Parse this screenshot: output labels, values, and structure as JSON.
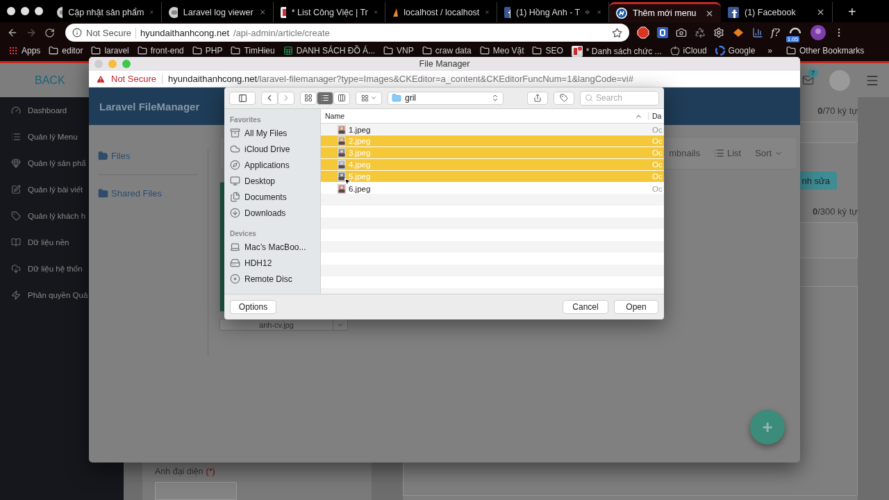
{
  "browser": {
    "tabs": [
      {
        "title": "Cập nhật sản phẩm",
        "kind": "circle",
        "selected": false,
        "audio": false
      },
      {
        "title": "Laravel log viewer",
        "kind": "circle",
        "selected": false,
        "audio": false
      },
      {
        "title": "* List Công Việc | Tr",
        "kind": "todo",
        "selected": false,
        "audio": false
      },
      {
        "title": "localhost / localhost",
        "kind": "sails",
        "selected": false,
        "audio": false
      },
      {
        "title": "(1) Hồng Anh - T",
        "kind": "facebook",
        "selected": false,
        "audio": true
      },
      {
        "title": "Thêm mới menu",
        "kind": "brand",
        "selected": true,
        "audio": false
      },
      {
        "title": "(1) Facebook",
        "kind": "facebook",
        "selected": false,
        "audio": false
      }
    ],
    "new_tab": "+",
    "address": {
      "security": "Not Secure",
      "host": "hyundaithanhcong.net",
      "path": "/api-admin/article/create"
    },
    "extension_text": "f?",
    "extension_badge": "1.05",
    "bookmarks": [
      {
        "label": "Apps",
        "kind": "apps"
      },
      {
        "label": "editor",
        "kind": "folder"
      },
      {
        "label": "laravel",
        "kind": "folder"
      },
      {
        "label": "front-end",
        "kind": "folder"
      },
      {
        "label": "PHP",
        "kind": "folder"
      },
      {
        "label": "TimHieu",
        "kind": "folder"
      },
      {
        "label": "DANH SÁCH ĐỒ Á...",
        "kind": "sheet"
      },
      {
        "label": "VNP",
        "kind": "folder"
      },
      {
        "label": "craw data",
        "kind": "folder"
      },
      {
        "label": "Meo Vặt",
        "kind": "folder"
      },
      {
        "label": "SEO",
        "kind": "folder"
      },
      {
        "label": "* Danh sách chức ...",
        "kind": "todo"
      },
      {
        "label": "iCloud",
        "kind": "apple"
      },
      {
        "label": "Google",
        "kind": "google"
      }
    ],
    "more": "»",
    "other_bookmarks": "Other Bookmarks"
  },
  "page": {
    "back": "BACK",
    "mail_count": "7",
    "sidebar": [
      {
        "label": "Dashboard",
        "kind": "gauge"
      },
      {
        "label": "Quản lý Menu",
        "kind": "list"
      },
      {
        "label": "Quản lý sản phẩ",
        "kind": "gem"
      },
      {
        "label": "Quản lý bài viết",
        "kind": "edit"
      },
      {
        "label": "Quản lý khách h",
        "kind": "tag"
      },
      {
        "label": "Dữ liệu nền",
        "kind": "book"
      },
      {
        "label": "Dữ liệu hệ thốn",
        "kind": "cloud"
      },
      {
        "label": "Phân quyền Quả",
        "kind": "bolt"
      }
    ],
    "title_counter": "**0**/70 ký tự",
    "edit_button": "nh sửa",
    "desc_counter": "**0**/300 ký tự",
    "avatar_label": "Anh đại diện",
    "required_mark": "(*)"
  },
  "popup": {
    "title": "File Manager",
    "security": "Not Secure",
    "host": "hyundaithanhcong.net",
    "path": "/laravel-filemanager?type=Images&CKEditor=a_content&CKEditorFuncNum=1&langCode=vi#",
    "brand": "Laravel FileManager",
    "folders": [
      {
        "label": "Files",
        "open": true
      },
      {
        "label": "Shared Files",
        "open": false
      }
    ],
    "thumbnails": "mbnails",
    "list": "List",
    "sort": "Sort",
    "file_select": "anh-cv.jpg",
    "fab": "+"
  },
  "dialog": {
    "view_modes": [
      {
        "kind": "icons",
        "selected": false
      },
      {
        "kind": "list",
        "selected": true
      },
      {
        "kind": "columns",
        "selected": false
      }
    ],
    "folder": "gril",
    "search_placeholder": "Search",
    "favorites_heading": "Favorites",
    "favorites": [
      {
        "label": "All My Files",
        "kind": "files"
      },
      {
        "label": "iCloud Drive",
        "kind": "cloud"
      },
      {
        "label": "Applications",
        "kind": "apps"
      },
      {
        "label": "Desktop",
        "kind": "desktop"
      },
      {
        "label": "Documents",
        "kind": "documents"
      },
      {
        "label": "Downloads",
        "kind": "downloads"
      }
    ],
    "devices_heading": "Devices",
    "devices": [
      {
        "label": "Mac’s MacBoo...",
        "kind": "laptop"
      },
      {
        "label": "HDH12",
        "kind": "disk"
      },
      {
        "label": "Remote Disc",
        "kind": "disc"
      }
    ],
    "columns": [
      "Name",
      "Da"
    ],
    "files": [
      {
        "name": "1.jpeg",
        "date": "Oc",
        "selected": false
      },
      {
        "name": "2.jpeg",
        "date": "Oc",
        "selected": true
      },
      {
        "name": "3.jpeg",
        "date": "Oc",
        "selected": true
      },
      {
        "name": "4.jpeg",
        "date": "Oc",
        "selected": true
      },
      {
        "name": "5.jpeg",
        "date": "Oc",
        "selected": true
      },
      {
        "name": "6.jpeg",
        "date": "Oc",
        "selected": false
      }
    ],
    "options": "Options",
    "cancel": "Cancel",
    "open": "Open"
  }
}
